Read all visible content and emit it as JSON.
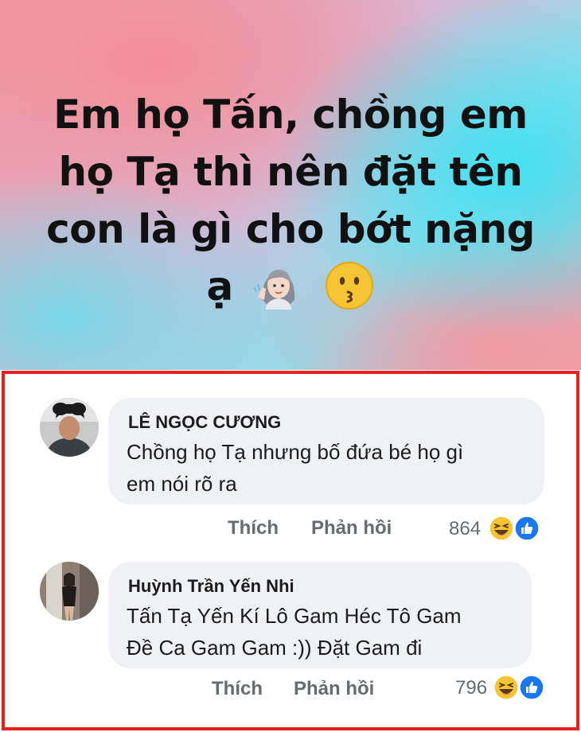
{
  "post": {
    "lines": [
      "Em họ Tấn, chồng em",
      "họ Tạ thì nên đặt tên",
      "con là gì cho bớt nặng",
      "ạ"
    ],
    "emojis": [
      "woman-tipping-hand-icon",
      "kissing-face-icon"
    ]
  },
  "comments": [
    {
      "author": "LÊ NGỌC CƯƠNG",
      "lines": [
        "Chồng họ Tạ nhưng bố đứa bé họ gì",
        "em nói rõ ra"
      ],
      "like_label": "Thích",
      "reply_label": "Phản hồi",
      "reaction_count": "864",
      "reactions": [
        "haha-icon",
        "like-icon"
      ]
    },
    {
      "author": "Huỳnh Trần Yến Nhi",
      "lines": [
        "Tấn Tạ Yến Kí Lô Gam Héc Tô Gam",
        "Đề Ca Gam Gam :)) Đặt Gam đi"
      ],
      "like_label": "Thích",
      "reply_label": "Phản hồi",
      "reaction_count": "796",
      "reactions": [
        "haha-icon",
        "like-icon"
      ]
    }
  ],
  "colors": {
    "highlight_border": "#e8201f",
    "bubble": "#eff1f4",
    "like_blue": "#1877f2",
    "haha_yellow": "#f7c533"
  }
}
